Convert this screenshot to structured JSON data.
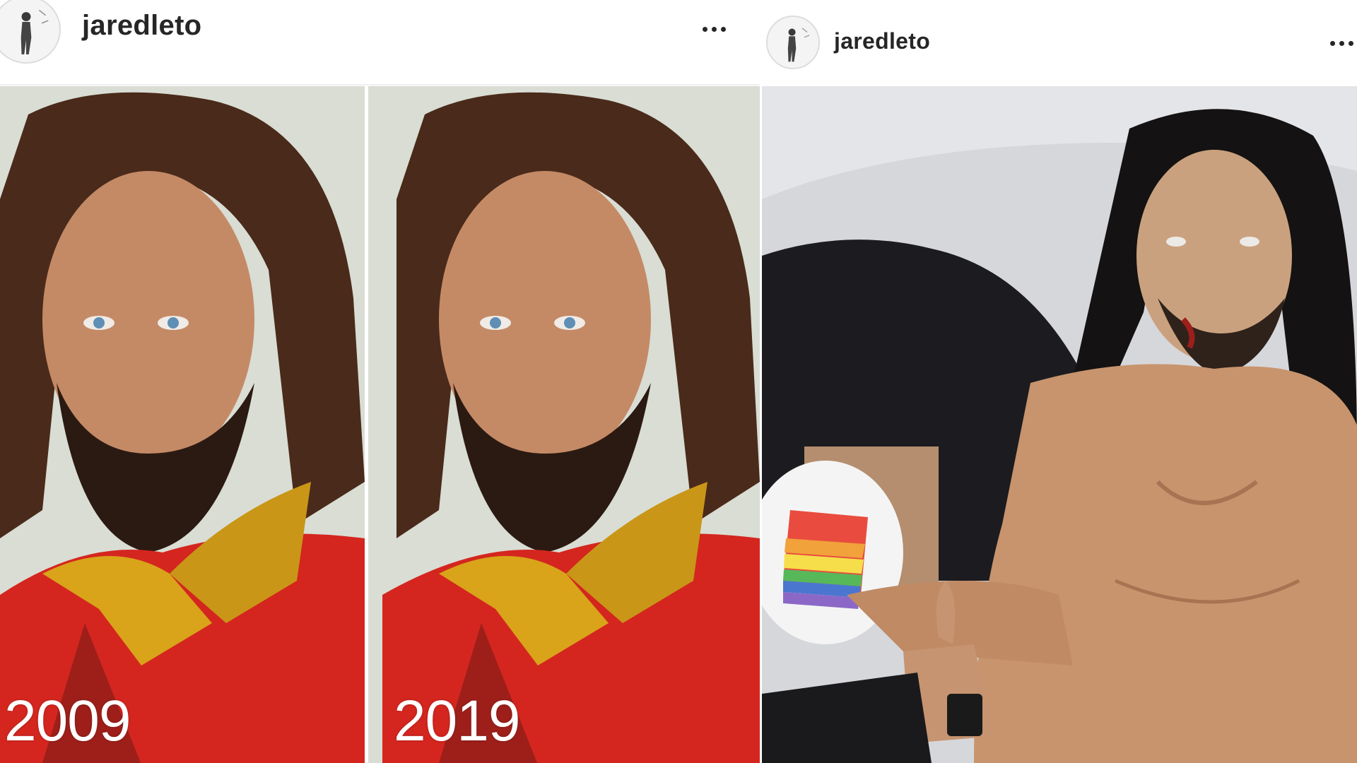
{
  "posts": [
    {
      "username": "jaredleto",
      "avatar_icon": "profile-avatar",
      "more_icon": "more-options-icon",
      "panels": [
        {
          "caption": "2009"
        },
        {
          "caption": "2019"
        }
      ]
    },
    {
      "username": "jaredleto",
      "avatar_icon": "profile-avatar",
      "more_icon": "more-options-icon"
    }
  ],
  "colors": {
    "username_text": "#262626",
    "background": "#ffffff",
    "jacket_red": "#d4261f",
    "collar_yellow": "#d9a31a"
  }
}
